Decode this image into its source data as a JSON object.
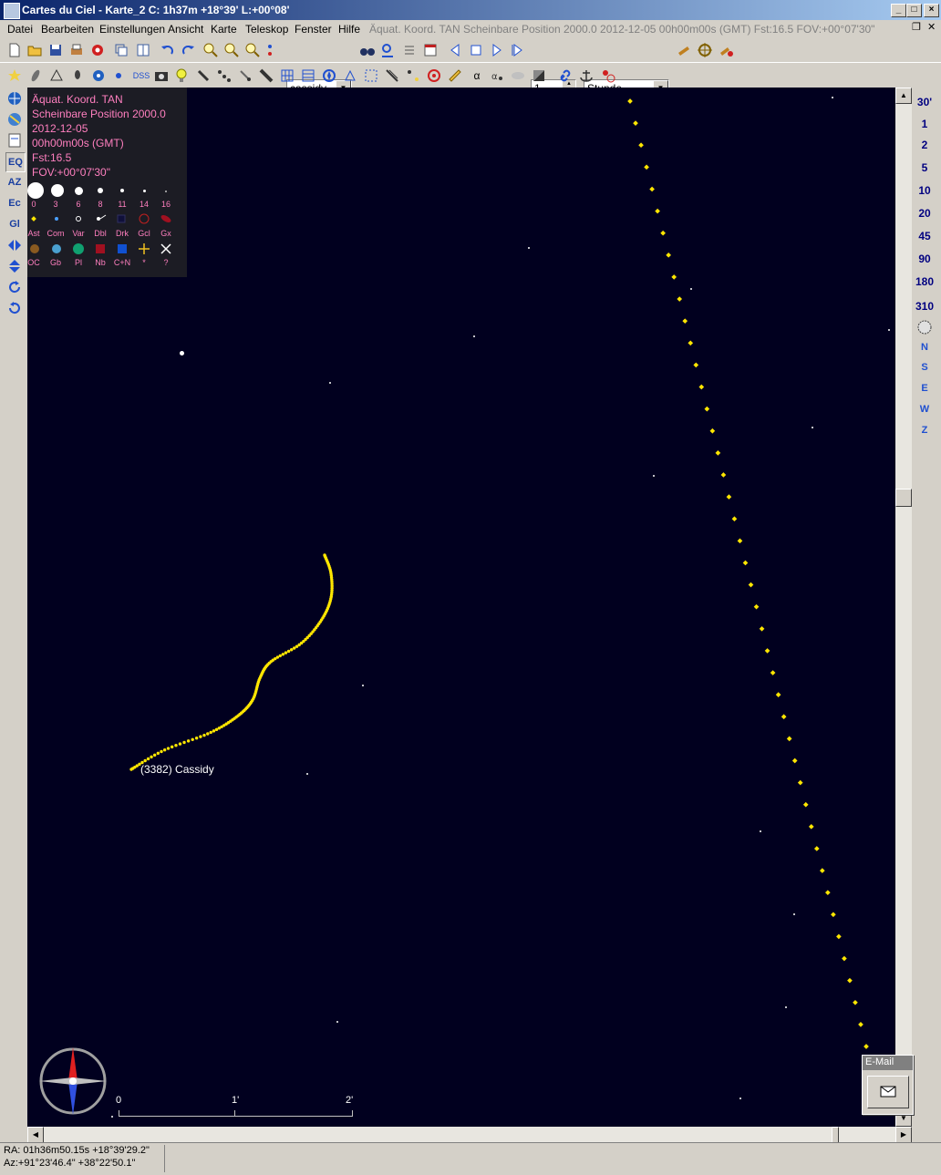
{
  "window": {
    "title": "Cartes du Ciel - Karte_2  C:  1h37m +18°39' L:+00°08'"
  },
  "menu": {
    "items": [
      "Datei",
      "Bearbeiten",
      "Einstellungen",
      "Ansicht",
      "Karte",
      "Teleskop",
      "Fenster",
      "Hilfe"
    ],
    "status_info": "Äquat. Koord. TAN Scheinbare Position 2000.0 2012-12-05 00h00m00s (GMT) Fst:16.5 FOV:+00°07'30\""
  },
  "toolbar": {
    "search_value": "cassidy",
    "step_value": "1",
    "unit_value": "Stunde",
    "dss_label": "DSS",
    "alpha_label": "α"
  },
  "left_toolbar": {
    "eq_label": "EQ",
    "az_label": "AZ",
    "ec_label": "Ec",
    "gl_label": "Gl"
  },
  "fov_buttons": [
    "30'",
    "1",
    "2",
    "5",
    "10",
    "20",
    "45",
    "90",
    "180",
    "310"
  ],
  "direction_buttons": [
    "N",
    "S",
    "E",
    "W",
    "Z"
  ],
  "chart_info": {
    "line1": "Äquat. Koord. TAN",
    "line2": "Scheinbare Position 2000.0",
    "line3": "2012-12-05",
    "line4": "00h00m00s (GMT)",
    "line5": "Fst:16.5",
    "line6": "FOV:+00°07'30\"",
    "magnitudes": [
      "0",
      "3",
      "6",
      "8",
      "11",
      "14",
      "16"
    ],
    "legend_row1": [
      "Ast",
      "Com",
      "Var",
      "Dbl",
      "Drk",
      "Gcl",
      "Gx"
    ],
    "legend_row2": [
      "OC",
      "Gb",
      "Pl",
      "Nb",
      "C+N",
      "*",
      "?"
    ]
  },
  "chart": {
    "object_label": "(3382) Cassidy",
    "scale_labels": [
      "0",
      "1'",
      "2'"
    ],
    "colors": {
      "background": "#01001f",
      "track": "#ffe600",
      "info_text": "#ff7fbf"
    }
  },
  "email_widget": {
    "title": "E-Mail"
  },
  "statusbar": {
    "radec": "RA: 01h36m50.15s +18°39'29.2\"",
    "altaz": "Az:+91°23'46.4\" +38°22'50.1\""
  }
}
